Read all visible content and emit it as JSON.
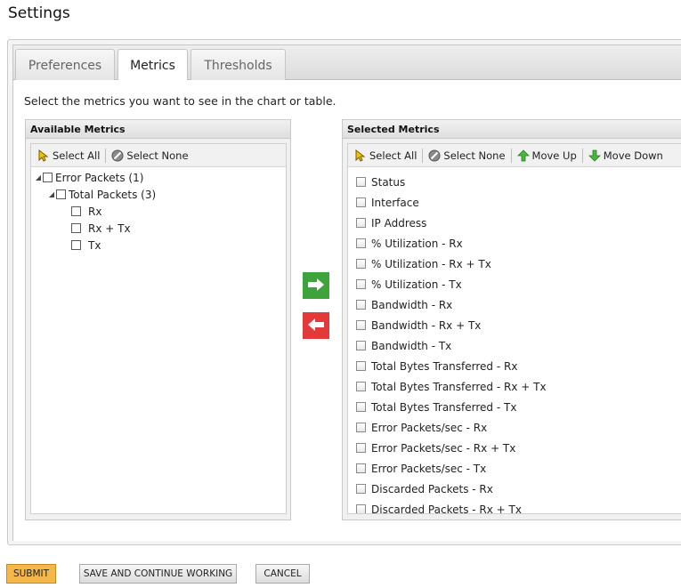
{
  "page": {
    "title": "Settings"
  },
  "tabs": [
    {
      "label": "Preferences",
      "active": false
    },
    {
      "label": "Metrics",
      "active": true
    },
    {
      "label": "Thresholds",
      "active": false
    }
  ],
  "instructions": "Select the metrics you want to see in the chart or table.",
  "available": {
    "header": "Available Metrics",
    "toolbar": {
      "select_all": "Select All",
      "select_none": "Select None"
    },
    "tree": [
      {
        "label": "Error Packets (1)",
        "level": 0,
        "expanded": true
      },
      {
        "label": "Total Packets (3)",
        "level": 1,
        "expanded": true
      },
      {
        "label": "Rx",
        "level": 2
      },
      {
        "label": "Rx + Tx",
        "level": 2
      },
      {
        "label": "Tx",
        "level": 2
      }
    ]
  },
  "selected": {
    "header": "Selected Metrics",
    "toolbar": {
      "select_all": "Select All",
      "select_none": "Select None",
      "move_up": "Move Up",
      "move_down": "Move Down"
    },
    "items": [
      "Status",
      "Interface",
      "IP Address",
      "% Utilization - Rx",
      "% Utilization - Rx + Tx",
      "% Utilization - Tx",
      "Bandwidth - Rx",
      "Bandwidth - Rx + Tx",
      "Bandwidth - Tx",
      "Total Bytes Transferred - Rx",
      "Total Bytes Transferred - Rx + Tx",
      "Total Bytes Transferred - Tx",
      "Error Packets/sec - Rx",
      "Error Packets/sec - Rx + Tx",
      "Error Packets/sec - Tx",
      "Discarded Packets - Rx",
      "Discarded Packets - Rx + Tx"
    ]
  },
  "buttons": {
    "submit": "SUBMIT",
    "save_continue": "SAVE AND CONTINUE WORKING",
    "cancel": "CANCEL"
  },
  "colors": {
    "submit": "#f4b84a",
    "move_right": "#3ea33a",
    "move_left": "#e23a3a"
  },
  "icons": {
    "select_all": "cursor-arrow-icon",
    "select_none": "no-entry-icon",
    "move_up": "green-up-arrow-icon",
    "move_down": "green-down-arrow-icon",
    "add": "right-arrow-icon",
    "remove": "left-arrow-icon",
    "expand": "expanded-triangle-icon"
  }
}
